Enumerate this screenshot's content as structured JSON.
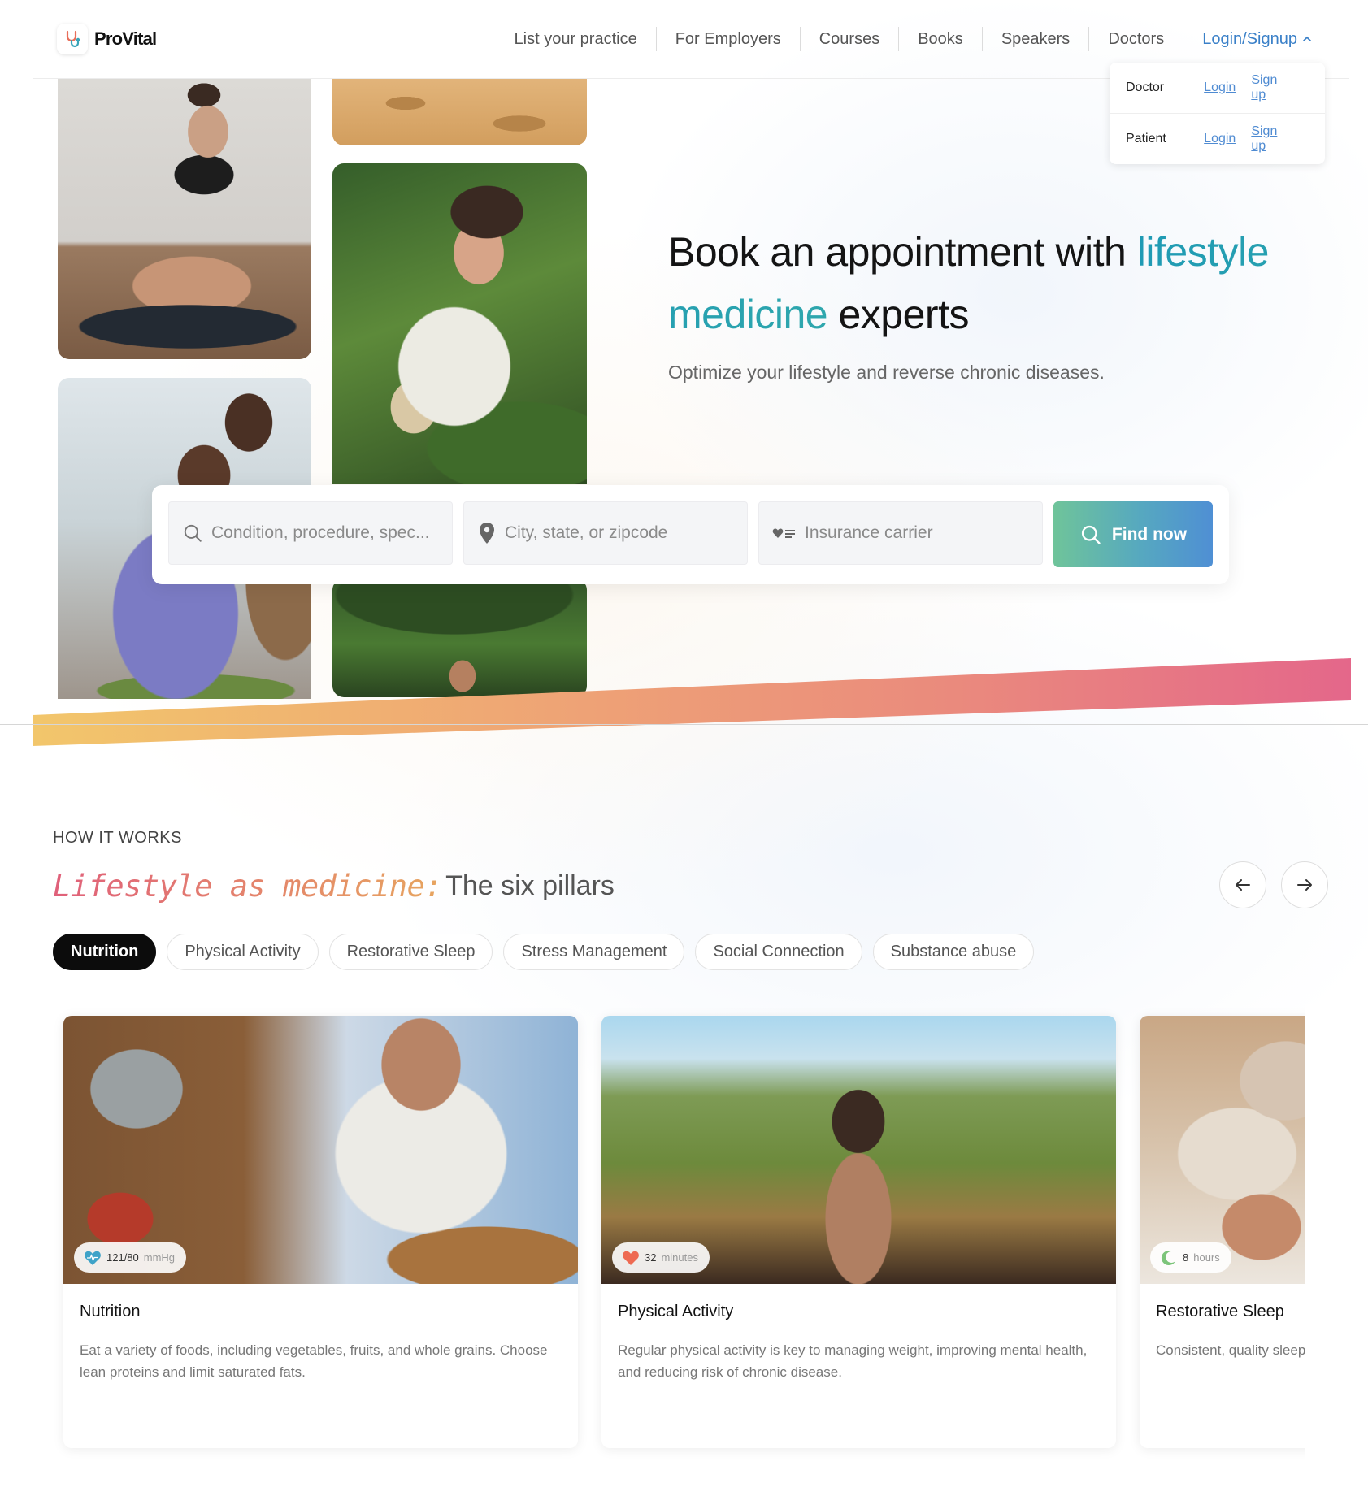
{
  "brand": {
    "name": "ProVital"
  },
  "nav": {
    "items": [
      "List your practice",
      "For Employers",
      "Courses",
      "Books",
      "Speakers",
      "Doctors"
    ],
    "login": "Login/Signup"
  },
  "dropdown": {
    "rows": [
      {
        "role": "Doctor",
        "login": "Login",
        "signup": "Sign up"
      },
      {
        "role": "Patient",
        "login": "Login",
        "signup": "Sign up"
      }
    ]
  },
  "hero": {
    "title_part1": "Book an appointment with ",
    "title_accent": "lifestyle medicine",
    "title_part2": " experts",
    "subtitle": "Optimize your lifestyle and reverse chronic diseases."
  },
  "search": {
    "condition_placeholder": "Condition, procedure, spec...",
    "location_placeholder": "City, state, or zipcode",
    "insurance_placeholder": "Insurance carrier",
    "button": "Find now"
  },
  "section": {
    "label": "HOW IT WORKS",
    "title_script": "Lifestyle as medicine:",
    "title_rest": "The six pillars"
  },
  "pills": [
    "Nutrition",
    "Physical Activity",
    "Restorative Sleep",
    "Stress Management",
    "Social Connection",
    "Substance abuse"
  ],
  "active_pill": "Nutrition",
  "cards": [
    {
      "badge_value": "121/80",
      "badge_unit": "mmHg",
      "badge_icon": "heart-icon",
      "title": "Nutrition",
      "text": "Eat a variety of foods, including vegetables, fruits, and whole grains. Choose lean proteins and limit saturated fats."
    },
    {
      "badge_value": "32",
      "badge_unit": "minutes",
      "badge_icon": "heart-icon",
      "title": "Physical Activity",
      "text": "Regular physical activity is key to managing weight, improving mental health, and reducing risk of chronic disease."
    },
    {
      "badge_value": "8",
      "badge_unit": "hours",
      "badge_icon": "moon-icon",
      "title": "Restorative Sleep",
      "text": "Consistent, quality sleep i physical ealth."
    }
  ],
  "colors": {
    "accent_blue": "#3a80c8",
    "accent_teal": "#1f9ab4",
    "band_start": "#f2c66b",
    "band_end": "#e4678a",
    "button_start": "#6fc49a",
    "button_end": "#4f8fd4"
  }
}
